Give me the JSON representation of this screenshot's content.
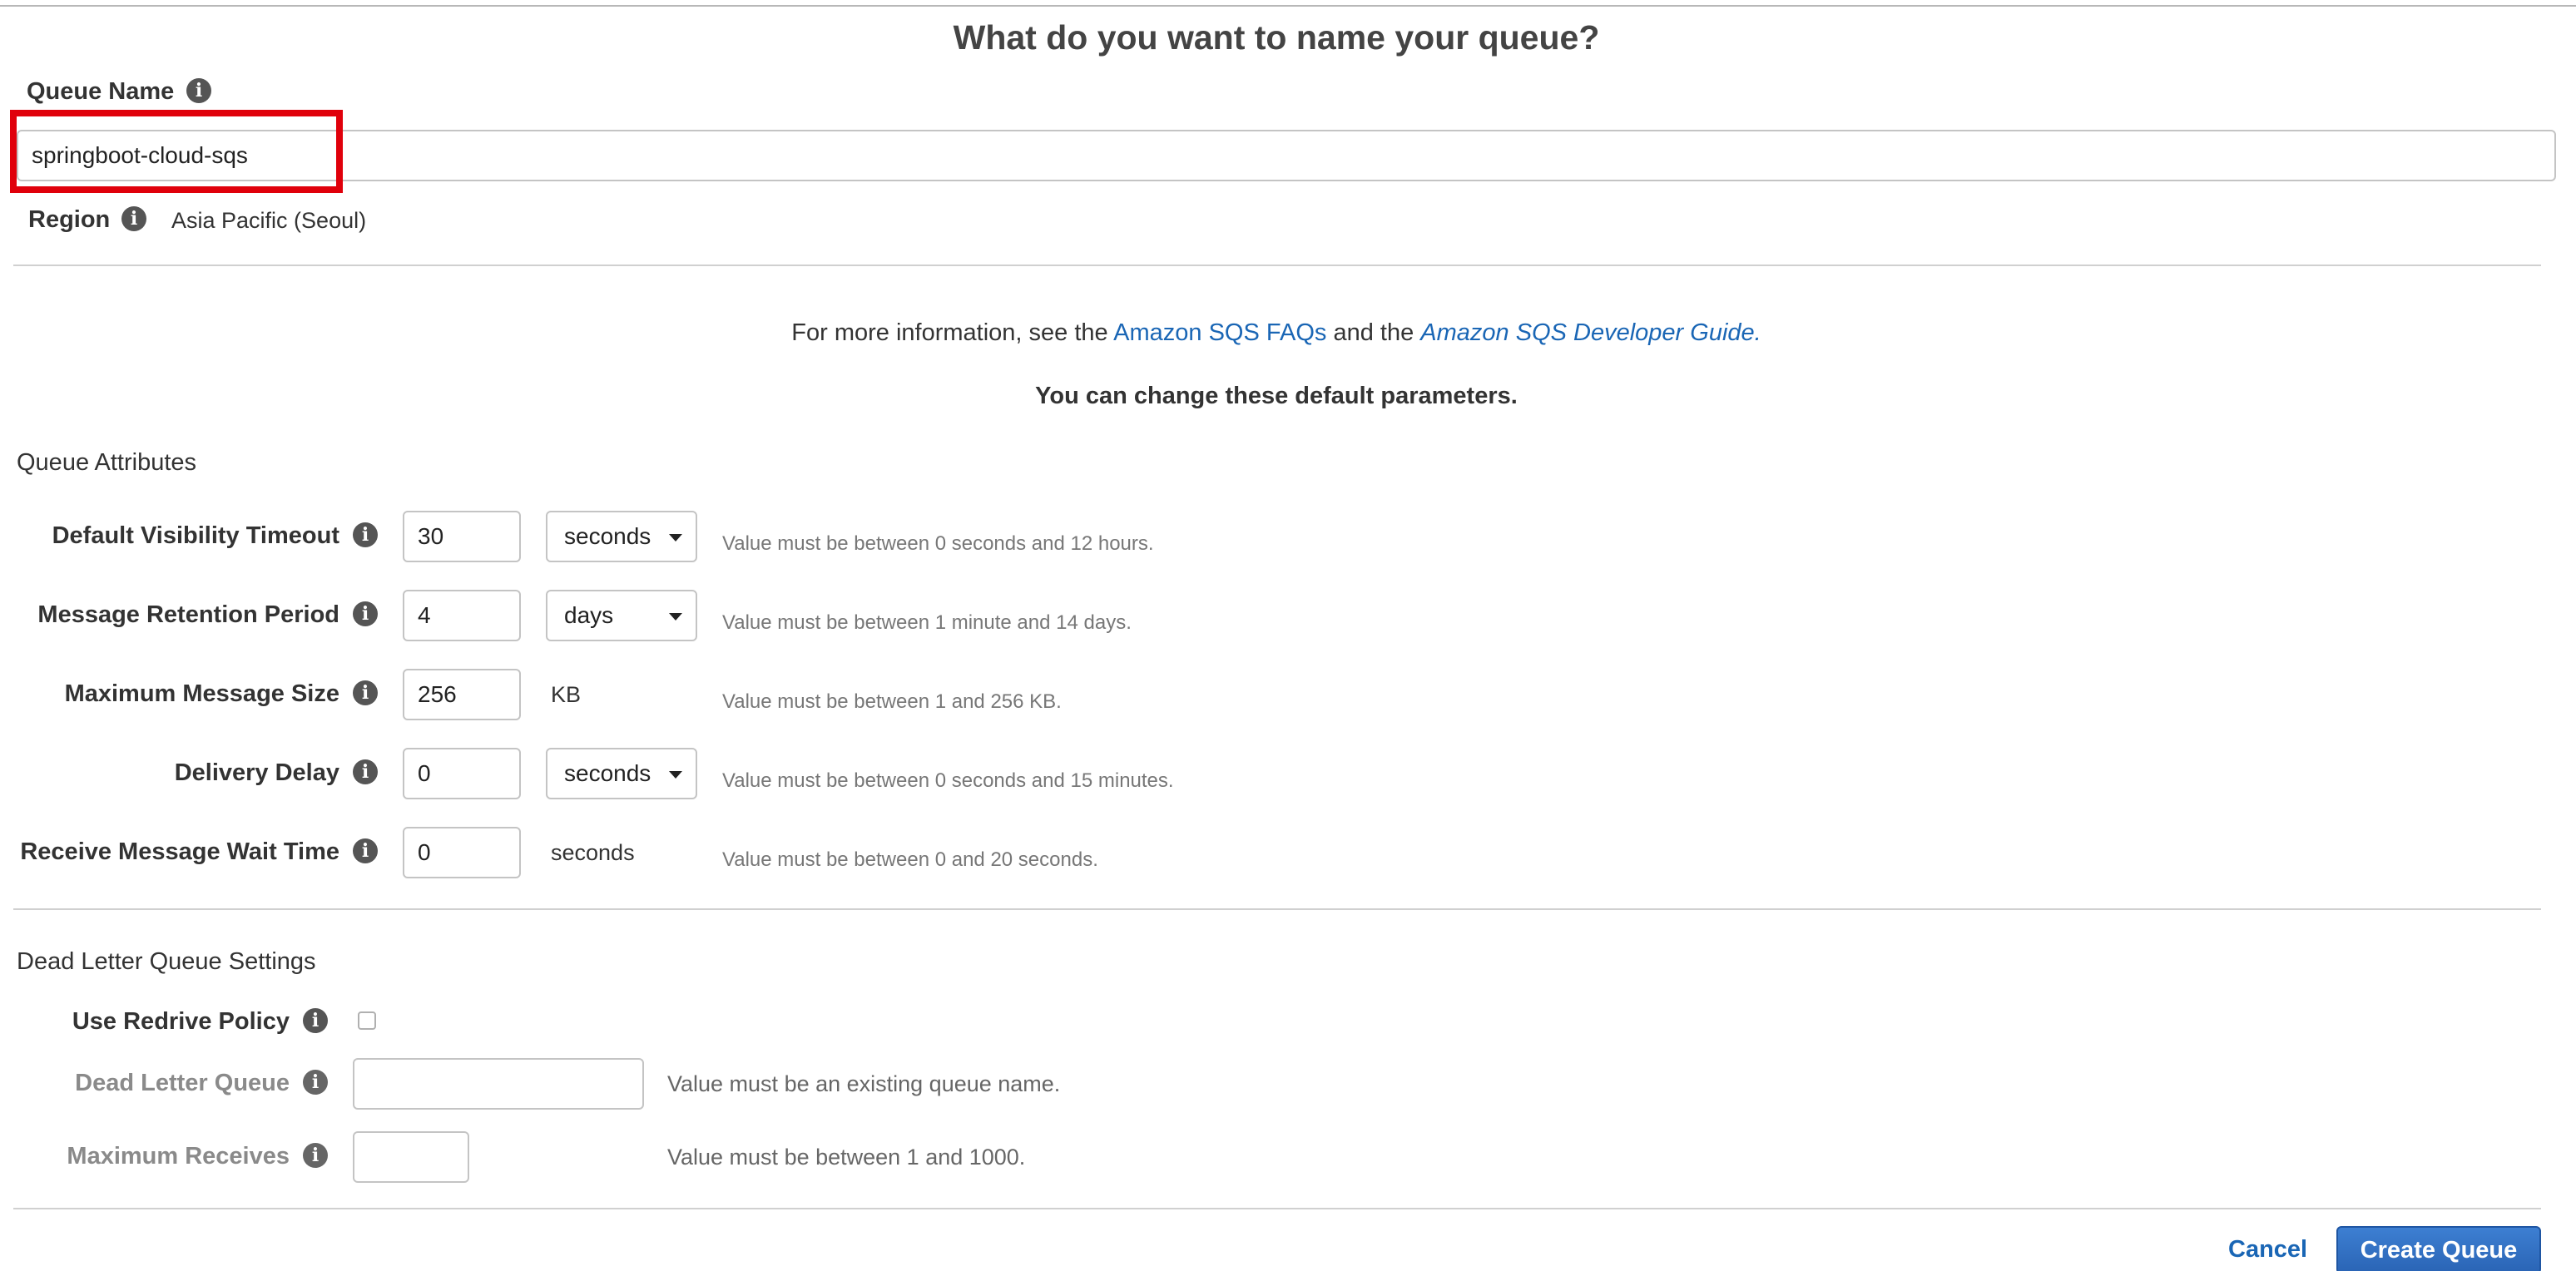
{
  "header": {
    "title": "What do you want to name your queue?"
  },
  "queue_name": {
    "label": "Queue Name",
    "value": "springboot-cloud-sqs"
  },
  "region": {
    "label": "Region",
    "value": "Asia Pacific (Seoul)"
  },
  "info_line": {
    "prefix": "For more information, see the",
    "faq_link": "Amazon SQS FAQs",
    "middle": "and the",
    "guide_link": "Amazon SQS Developer Guide",
    "suffix": "."
  },
  "defaults_note": "You can change these default parameters.",
  "queue_attributes": {
    "section_title": "Queue Attributes",
    "visibility_timeout": {
      "label": "Default Visibility Timeout",
      "value": "30",
      "unit": "seconds",
      "hint": "Value must be between 0 seconds and 12 hours."
    },
    "retention_period": {
      "label": "Message Retention Period",
      "value": "4",
      "unit": "days",
      "hint": "Value must be between 1 minute and 14 days."
    },
    "max_message_size": {
      "label": "Maximum Message Size",
      "value": "256",
      "unit": "KB",
      "hint": "Value must be between 1 and 256 KB."
    },
    "delivery_delay": {
      "label": "Delivery Delay",
      "value": "0",
      "unit": "seconds",
      "hint": "Value must be between 0 seconds and 15 minutes."
    },
    "receive_wait_time": {
      "label": "Receive Message Wait Time",
      "value": "0",
      "unit": "seconds",
      "hint": "Value must be between 0 and 20 seconds."
    }
  },
  "dead_letter": {
    "section_title": "Dead Letter Queue Settings",
    "use_redrive": {
      "label": "Use Redrive Policy",
      "checked": false
    },
    "dead_letter_queue": {
      "label": "Dead Letter Queue",
      "value": "",
      "hint": "Value must be an existing queue name."
    },
    "max_receives": {
      "label": "Maximum Receives",
      "value": "",
      "hint": "Value must be between 1 and 1000."
    }
  },
  "actions": {
    "cancel_label": "Cancel",
    "create_label": "Create Queue"
  },
  "colors": {
    "link": "#1a66b5",
    "primary_button": "#2a64b5",
    "highlight_box": "#e0000b"
  }
}
